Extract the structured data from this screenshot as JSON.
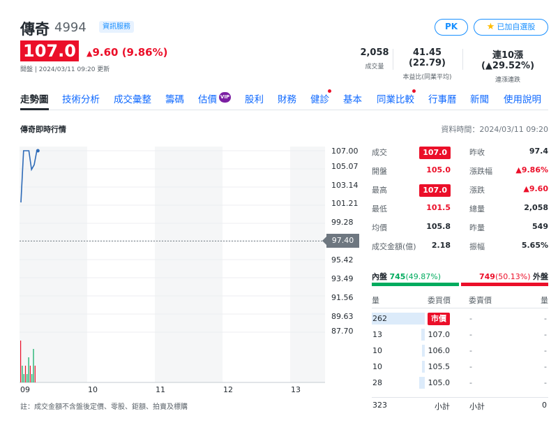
{
  "header": {
    "name": "傳奇",
    "code": "4994",
    "badge": "資訊服務",
    "pk_label": "PK",
    "watchlist_label": "已加自選股",
    "price": "107.0",
    "change": "9.60 (9.86%)",
    "status": "開盤 | 2024/03/11 09:20 更新"
  },
  "stats": [
    {
      "value": "2,058",
      "label": "成交量"
    },
    {
      "value": "41.45 (22.79)",
      "label": "本益比(同業平均)"
    },
    {
      "value": "連10漲 (▲29.52%)",
      "label": "連漲連跌"
    }
  ],
  "tabs": [
    "走勢圖",
    "技術分析",
    "成交彙整",
    "籌碼",
    "估價",
    "股利",
    "財務",
    "健診",
    "基本",
    "同業比較",
    "行事曆",
    "新聞",
    "使用說明"
  ],
  "vip_label": "VIP",
  "section": {
    "title": "傳奇即時行情",
    "data_time": "資料時間：2024/03/11 09:20"
  },
  "chart_data": {
    "type": "line",
    "y_ticks": [
      "107.00",
      "105.07",
      "103.14",
      "101.21",
      "99.28",
      "97.40",
      "95.42",
      "93.49",
      "91.56",
      "89.63",
      "87.70"
    ],
    "x_ticks": [
      "09",
      "10",
      "11",
      "12",
      "13"
    ],
    "ylim": [
      87.7,
      107.0
    ],
    "reference_price": "97.40",
    "series": [
      {
        "values": [
          101.5,
          107.0,
          107.0,
          107.0,
          105.0,
          105.5,
          107.0
        ]
      }
    ],
    "volume": [
      5,
      2,
      1,
      2,
      1,
      3,
      2,
      1,
      4,
      2
    ]
  },
  "footnote": "註：成交金額不含盤後定價、零股、鉅額、拍賣及標購",
  "quote": {
    "left": [
      {
        "label": "成交",
        "value": "107.0"
      },
      {
        "label": "開盤",
        "value": "105.0"
      },
      {
        "label": "最高",
        "value": "107.0"
      },
      {
        "label": "最低",
        "value": "101.5"
      },
      {
        "label": "均價",
        "value": "105.8"
      },
      {
        "label": "成交金額(億)",
        "value": "2.18"
      }
    ],
    "right": [
      {
        "label": "昨收",
        "value": "97.4"
      },
      {
        "label": "漲跌幅",
        "value": "▲9.86%"
      },
      {
        "label": "漲跌",
        "value": "▲9.60"
      },
      {
        "label": "總量",
        "value": "2,058"
      },
      {
        "label": "昨量",
        "value": "549"
      },
      {
        "label": "振幅",
        "value": "5.65%"
      }
    ]
  },
  "inout": {
    "inner_label": "內盤",
    "inner_value": "745",
    "inner_pct": "(49.87%)",
    "outer_value": "749",
    "outer_pct": "(50.13%)",
    "outer_label": "外盤"
  },
  "orderbook": {
    "headers": [
      "量",
      "委買價",
      "委賣價",
      "量"
    ],
    "rows": [
      {
        "bid_vol": "262",
        "bid_price": "市價",
        "ask_price": "-",
        "ask_vol": "-"
      },
      {
        "bid_vol": "13",
        "bid_price": "107.0",
        "ask_price": "-",
        "ask_vol": "-"
      },
      {
        "bid_vol": "10",
        "bid_price": "106.0",
        "ask_price": "-",
        "ask_vol": "-"
      },
      {
        "bid_vol": "10",
        "bid_price": "105.5",
        "ask_price": "-",
        "ask_vol": "-"
      },
      {
        "bid_vol": "28",
        "bid_price": "105.0",
        "ask_price": "-",
        "ask_vol": "-"
      }
    ],
    "footer": {
      "bid_total": "323",
      "bid_label": "小計",
      "ask_label": "小計",
      "ask_total": "0"
    }
  }
}
